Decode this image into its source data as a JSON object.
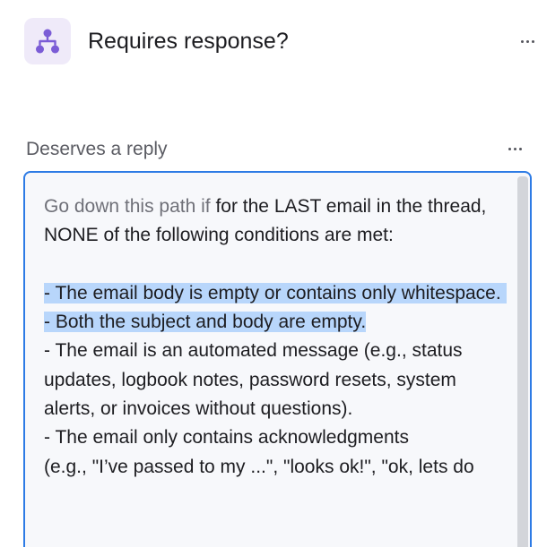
{
  "node": {
    "title": "Requires response?",
    "icon": "branch-icon",
    "icon_color": "#7b5cd6",
    "icon_bg": "#efeaf9"
  },
  "path": {
    "label": "Deserves a reply",
    "prefix": "Go down this path if",
    "intro": " for the LAST email in the thread, NONE of the following conditions are met:",
    "selected_lines": [
      "- The email body is empty or contains only whitespace. ",
      "- Both the subject and body are empty."
    ],
    "lines": [
      "- The email is an automated message (e.g., status updates, logbook notes, password resets, system alerts, or invoices without questions).",
      "- The email only contains acknowledgments",
      "(e.g., \"I’ve passed to my ...\", \"looks ok!\", \"ok, lets do"
    ]
  },
  "colors": {
    "focus_border": "#2d7be5",
    "selection": "#b8d6fb"
  }
}
